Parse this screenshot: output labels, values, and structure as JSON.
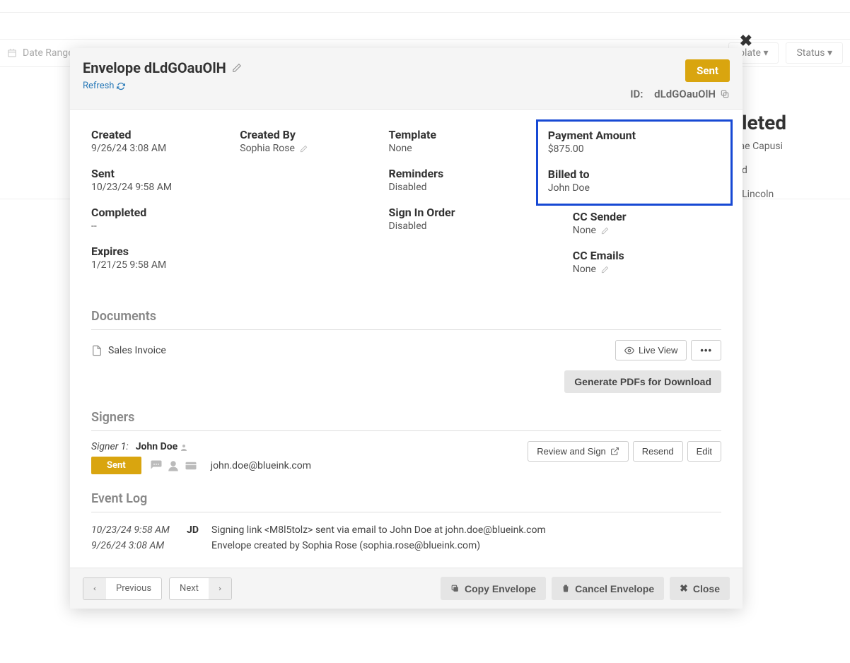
{
  "background": {
    "filter_daterange": "Date Range",
    "filter_template": "plate",
    "filter_status": "Status",
    "completed_heading": "pleted",
    "names": [
      "Mae Capusi",
      "ond",
      "m Lincoln"
    ]
  },
  "modal": {
    "title_prefix": "Envelope",
    "title_id": "dLdGOauOlH",
    "refresh_label": "Refresh",
    "status": "Sent",
    "id_label": "ID:",
    "id_value": "dLdGOauOlH",
    "info": {
      "created_label": "Created",
      "created_value": "9/26/24 3:08 AM",
      "sent_label": "Sent",
      "sent_value": "10/23/24 9:58 AM",
      "completed_label": "Completed",
      "completed_value": "--",
      "expires_label": "Expires",
      "expires_value": "1/21/25 9:58 AM",
      "created_by_label": "Created By",
      "created_by_value": "Sophia Rose",
      "template_label": "Template",
      "template_value": "None",
      "reminders_label": "Reminders",
      "reminders_value": "Disabled",
      "sign_order_label": "Sign In Order",
      "sign_order_value": "Disabled",
      "payment_label": "Payment Amount",
      "payment_value": "$875.00",
      "billed_label": "Billed to",
      "billed_value": "John Doe",
      "cc_sender_label": "CC Sender",
      "cc_sender_value": "None",
      "cc_emails_label": "CC Emails",
      "cc_emails_value": "None"
    },
    "documents": {
      "heading": "Documents",
      "items": [
        "Sales Invoice"
      ],
      "live_view_label": "Live View",
      "generate_label": "Generate PDFs for Download"
    },
    "signers": {
      "heading": "Signers",
      "signer_label": "Signer 1:",
      "signer_name": "John Doe",
      "signer_status": "Sent",
      "signer_email": "john.doe@blueink.com",
      "review_label": "Review and Sign",
      "resend_label": "Resend",
      "edit_label": "Edit"
    },
    "event_log": {
      "heading": "Event Log",
      "rows": [
        {
          "date": "10/23/24 9:58 AM",
          "initials": "JD",
          "text": "Signing link <M8l5tolz> sent via email to John Doe at john.doe@blueink.com"
        },
        {
          "date": "9/26/24 3:08 AM",
          "initials": "",
          "text": "Envelope created by Sophia Rose (sophia.rose@blueink.com)"
        }
      ]
    },
    "footer": {
      "previous_label": "Previous",
      "next_label": "Next",
      "copy_label": "Copy Envelope",
      "cancel_label": "Cancel Envelope",
      "close_label": "Close"
    }
  }
}
